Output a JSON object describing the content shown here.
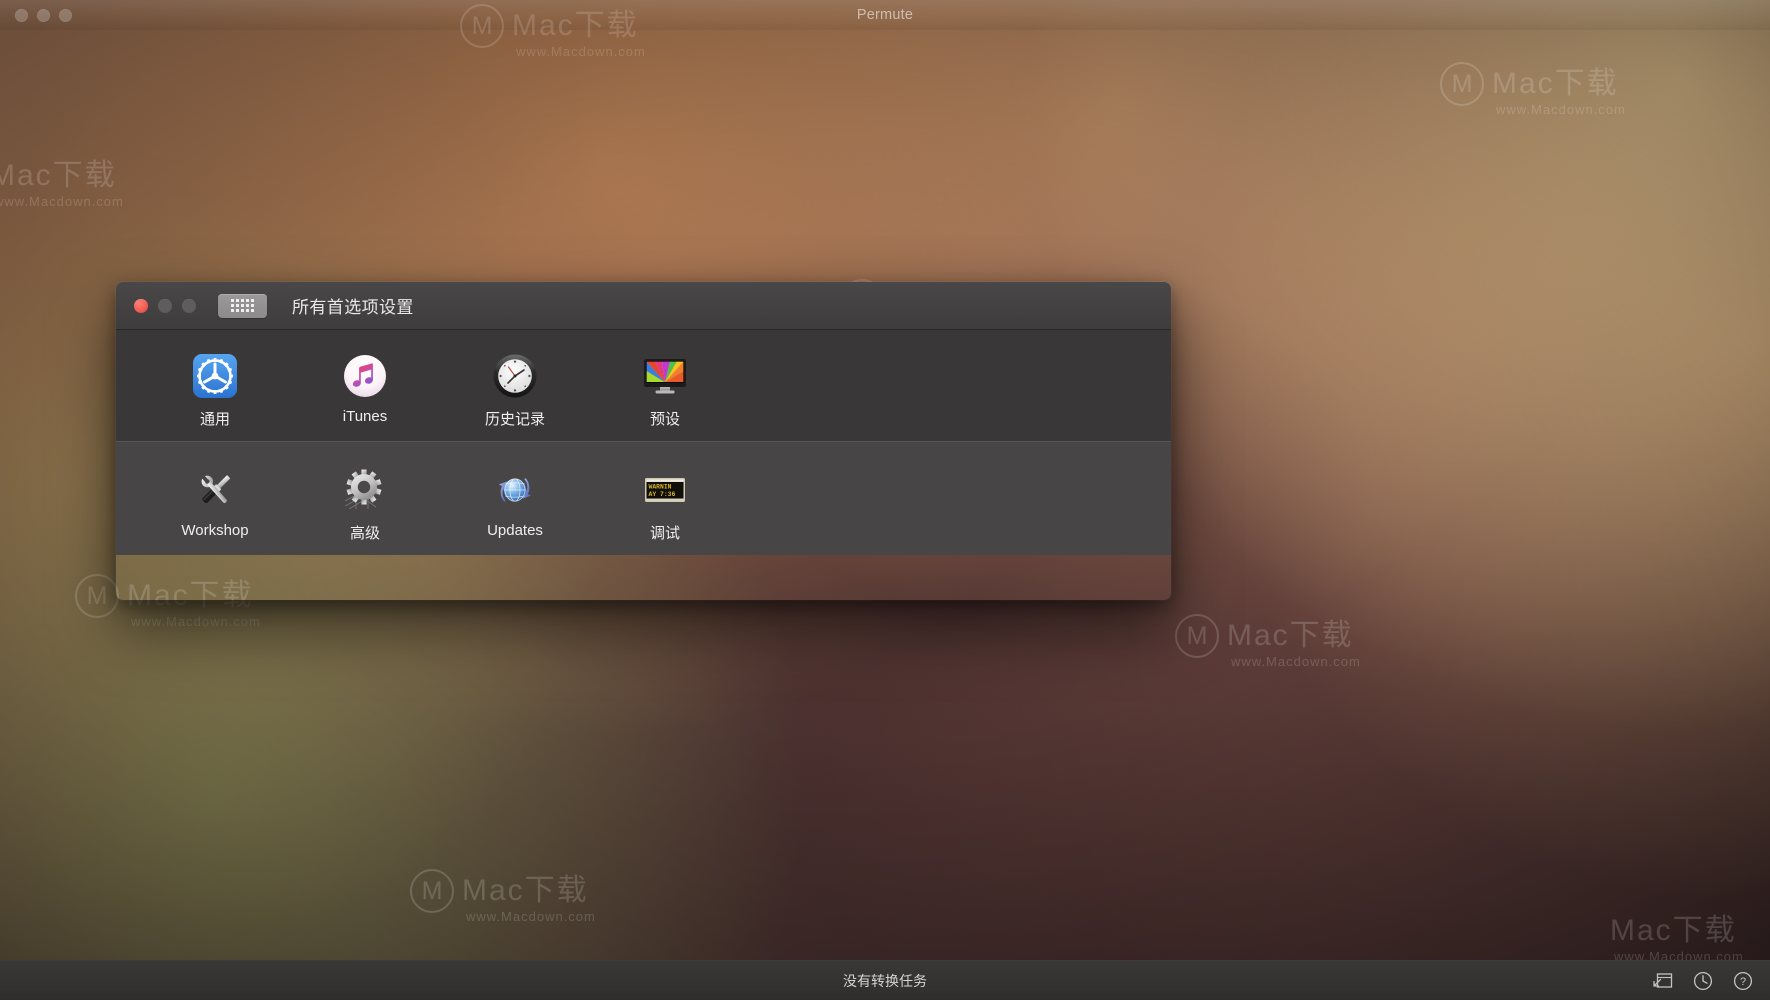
{
  "main_window": {
    "title": "Permute",
    "traffic_lights": [
      "close",
      "minimize",
      "zoom"
    ]
  },
  "prefs_window": {
    "title": "所有首选项设置",
    "show_all_button": {
      "name": "show-all",
      "icon": "grid-icon"
    },
    "traffic_lights": {
      "close": "close",
      "minimize": "minimize",
      "zoom": "zoom"
    },
    "sections": [
      {
        "id": "primary",
        "items": [
          {
            "label": "通用",
            "icon": "gear-settings-icon"
          },
          {
            "label": "iTunes",
            "icon": "itunes-note-icon"
          },
          {
            "label": "历史记录",
            "icon": "clock-icon"
          },
          {
            "label": "预设",
            "icon": "display-monitor-icon"
          }
        ]
      },
      {
        "id": "secondary",
        "items": [
          {
            "label": "Workshop",
            "icon": "screwdriver-wrench-icon"
          },
          {
            "label": "高级",
            "icon": "gear-blueprint-icon"
          },
          {
            "label": "Updates",
            "icon": "globe-refresh-icon"
          },
          {
            "label": "调试",
            "icon": "console-warning-icon",
            "screen_lines": [
              "WARNIN",
              "AY 7:36"
            ]
          }
        ]
      }
    ]
  },
  "status_bar": {
    "message": "没有转换任务",
    "icons": [
      {
        "name": "drop-target-icon"
      },
      {
        "name": "clock-icon"
      },
      {
        "name": "help-icon"
      }
    ]
  },
  "watermarks": {
    "brand": "Mac下载",
    "url": "www.Macdown.com",
    "mark": "M"
  },
  "colors": {
    "accent_blue": "#3f8ee8",
    "close_red": "#ee5b50",
    "panel_primary": "#393737",
    "panel_secondary": "#474545",
    "titlebar": "#434141",
    "statusbar": "#353232",
    "label_text": "#efefef"
  }
}
